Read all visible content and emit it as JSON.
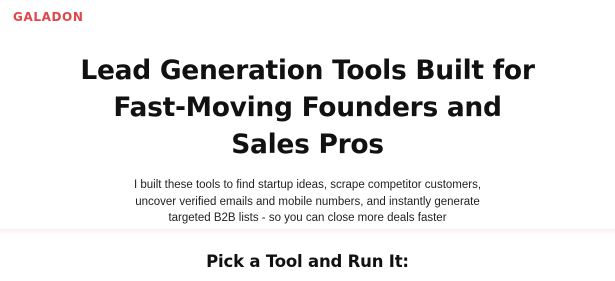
{
  "header": {
    "logo_text": "GALADON",
    "brand_color": "#e0464a"
  },
  "hero": {
    "headline_lines": [
      "Lead Generation Tools Built for",
      "Fast-Moving Founders and",
      "Sales Pros"
    ],
    "intro_lines": [
      "I built these tools to find startup ideas, scrape competitor customers,",
      "uncover verified emails and mobile numbers, and instantly generate",
      "targeted B2B lists - so you can close more deals faster"
    ]
  },
  "tools_section": {
    "title": "Pick a Tool and Run It:"
  }
}
